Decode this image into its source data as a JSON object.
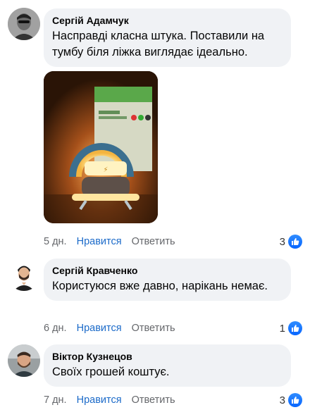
{
  "comments": [
    {
      "author": "Сергій Адамчук",
      "text": "Насправді класна штука. Поставили на тумбу біля ліжка виглядає ідеально.",
      "time": "5 дн.",
      "like_label": "Нравится",
      "reply_label": "Ответить",
      "reaction_count": "3",
      "reaction_icon": "thumbs-up-icon",
      "has_photo": true
    },
    {
      "author": "Сергій Кравченко",
      "text": "Користуюся вже давно, нарікань немає.",
      "time": "6 дн.",
      "like_label": "Нравится",
      "reply_label": "Ответить",
      "reaction_count": "1",
      "reaction_icon": "thumbs-up-icon"
    },
    {
      "author": "Віктор Кузнецов",
      "text": "Своїх грошей коштує.",
      "time": "7 дн.",
      "like_label": "Нравится",
      "reply_label": "Ответить",
      "reaction_count": "3",
      "reaction_icon": "thumbs-up-icon"
    }
  ],
  "colors": {
    "bubble_bg": "#f0f2f5",
    "link_blue": "#1b6ac9",
    "meta_gray": "#65676b",
    "reaction_blue": "#0866ff"
  }
}
